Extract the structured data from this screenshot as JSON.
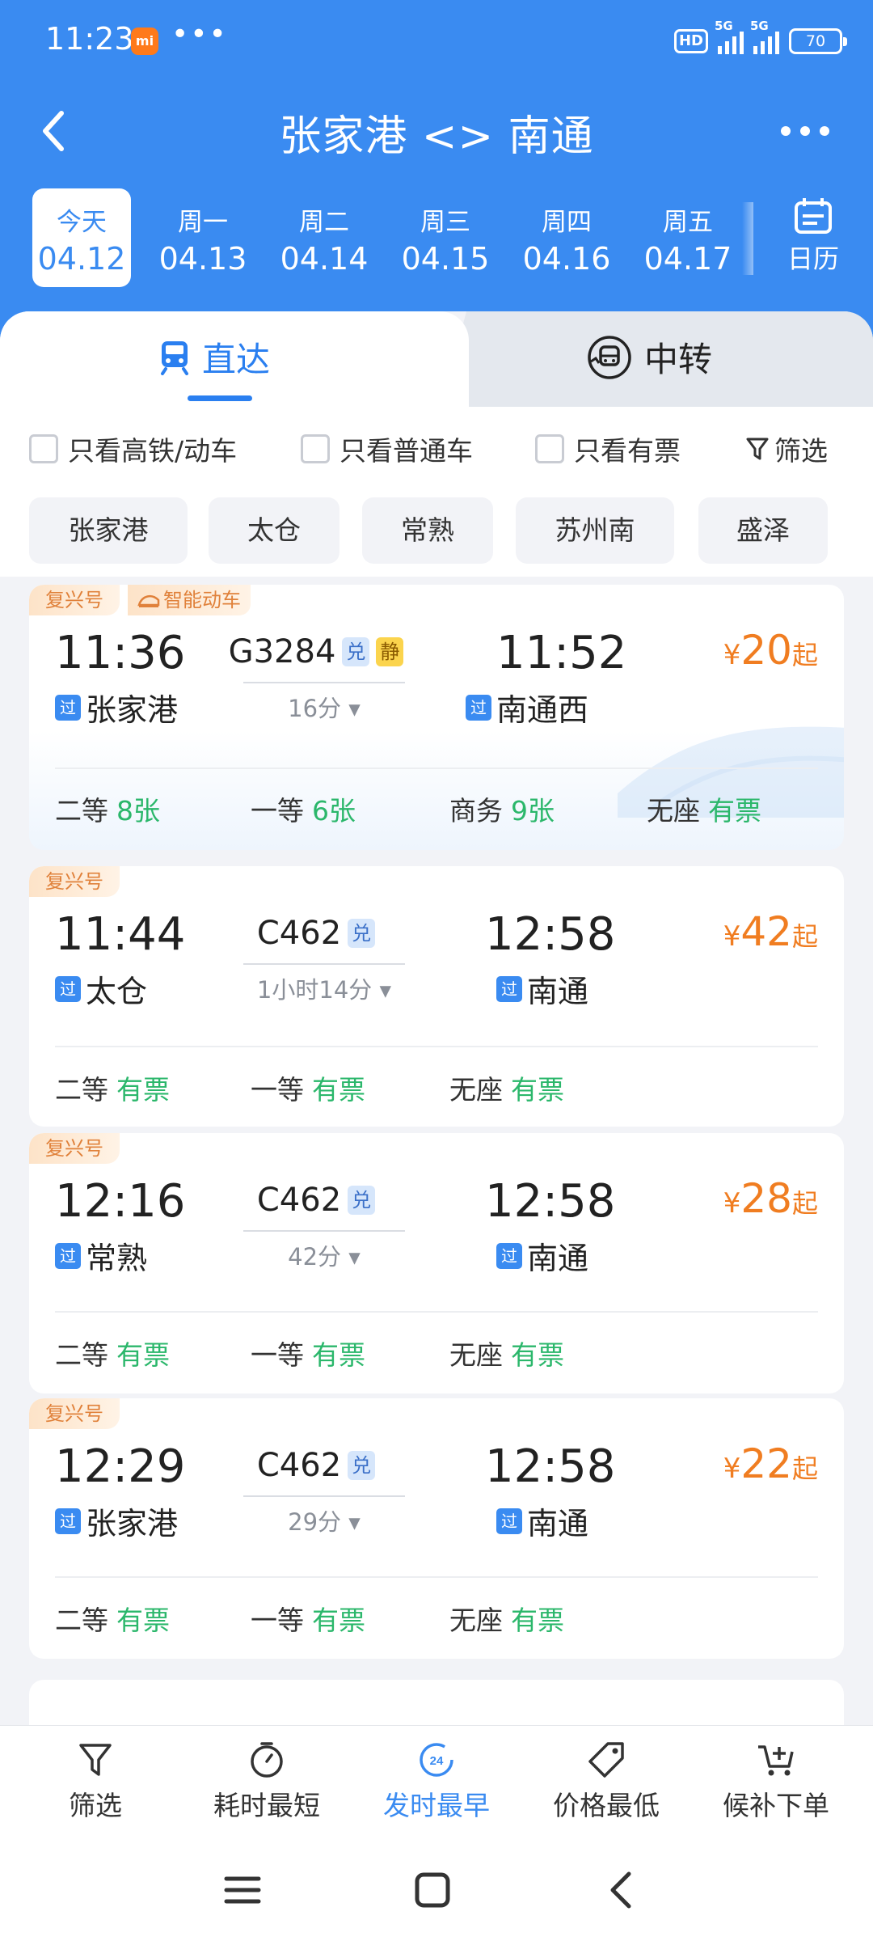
{
  "status_bar": {
    "time": "11:23",
    "mi_label": "mi",
    "dots": "•••",
    "hd": "HD",
    "net1": "5G",
    "net2": "5G",
    "battery": "70"
  },
  "nav": {
    "title": "张家港 <> 南通",
    "back_icon": "back-chevron-icon",
    "more_icon": "more-icon"
  },
  "dates": [
    {
      "weekday": "今天",
      "date": "04.12",
      "active": true
    },
    {
      "weekday": "周一",
      "date": "04.13"
    },
    {
      "weekday": "周二",
      "date": "04.14"
    },
    {
      "weekday": "周三",
      "date": "04.15"
    },
    {
      "weekday": "周四",
      "date": "04.16"
    },
    {
      "weekday": "周五",
      "date": "04.17"
    }
  ],
  "calendar_label": "日历",
  "tabs": {
    "direct": "直达",
    "transfer": "中转"
  },
  "filters": {
    "high_speed": "只看高铁/动车",
    "normal": "只看普通车",
    "available": "只看有票",
    "screen": "筛选"
  },
  "stations": [
    "张家港",
    "太仓",
    "常熟",
    "苏州南",
    "盛泽"
  ],
  "trains": [
    {
      "badge": "复兴号",
      "smart_badge": "智能动车",
      "dep": "11:36",
      "no": "G3284",
      "tags": [
        "兑",
        "静"
      ],
      "duration": "16分 ▾",
      "arr": "11:52",
      "dep_station": "张家港",
      "arr_station": "南通西",
      "price_yen": "¥",
      "price": "20",
      "price_suffix": "起",
      "guo": "过",
      "seats": [
        {
          "name": "二等",
          "count": "8张"
        },
        {
          "name": "一等",
          "count": "6张"
        },
        {
          "name": "商务",
          "count": "9张"
        },
        {
          "name": "无座",
          "count": "有票"
        }
      ]
    },
    {
      "badge": "复兴号",
      "dep": "11:44",
      "no": "C462",
      "tags": [
        "兑"
      ],
      "duration": "1小时14分 ▾",
      "arr": "12:58",
      "dep_station": "太仓",
      "arr_station": "南通",
      "price_yen": "¥",
      "price": "42",
      "price_suffix": "起",
      "guo": "过",
      "seats": [
        {
          "name": "二等",
          "count": "有票"
        },
        {
          "name": "一等",
          "count": "有票"
        },
        {
          "name": "无座",
          "count": "有票"
        }
      ]
    },
    {
      "badge": "复兴号",
      "dep": "12:16",
      "no": "C462",
      "tags": [
        "兑"
      ],
      "duration": "42分 ▾",
      "arr": "12:58",
      "dep_station": "常熟",
      "arr_station": "南通",
      "price_yen": "¥",
      "price": "28",
      "price_suffix": "起",
      "guo": "过",
      "seats": [
        {
          "name": "二等",
          "count": "有票"
        },
        {
          "name": "一等",
          "count": "有票"
        },
        {
          "name": "无座",
          "count": "有票"
        }
      ]
    },
    {
      "badge": "复兴号",
      "dep": "12:29",
      "no": "C462",
      "tags": [
        "兑"
      ],
      "duration": "29分 ▾",
      "arr": "12:58",
      "dep_station": "张家港",
      "arr_station": "南通",
      "price_yen": "¥",
      "price": "22",
      "price_suffix": "起",
      "guo": "过",
      "seats": [
        {
          "name": "二等",
          "count": "有票"
        },
        {
          "name": "一等",
          "count": "有票"
        },
        {
          "name": "无座",
          "count": "有票"
        }
      ]
    }
  ],
  "bottom_bar": [
    {
      "label": "筛选",
      "icon": "filter-icon"
    },
    {
      "label": "耗时最短",
      "icon": "stopwatch-icon"
    },
    {
      "label": "发时最早",
      "icon": "clock-24-icon",
      "active": true
    },
    {
      "label": "价格最低",
      "icon": "price-tag-icon"
    },
    {
      "label": "候补下单",
      "icon": "cart-plus-icon"
    }
  ],
  "colors": {
    "primary": "#3a8bf1",
    "price": "#f07d21",
    "available": "#2bb76b"
  }
}
